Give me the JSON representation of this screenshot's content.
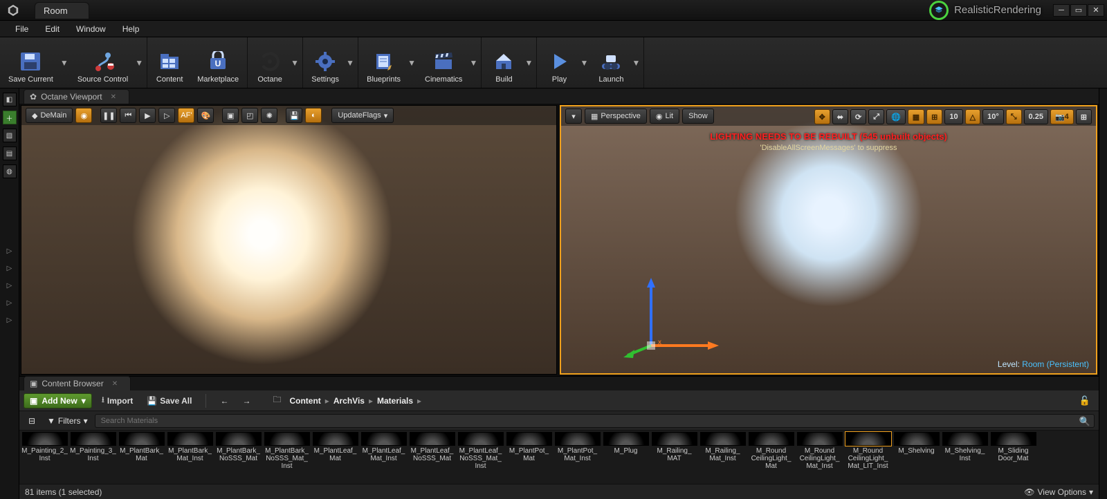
{
  "title_tab": "Room",
  "project_name": "RealisticRendering",
  "menu": {
    "file": "File",
    "edit": "Edit",
    "window": "Window",
    "help": "Help"
  },
  "toolbar": {
    "save": "Save Current",
    "source": "Source Control",
    "content": "Content",
    "market": "Marketplace",
    "octane": "Octane",
    "settings": "Settings",
    "blueprints": "Blueprints",
    "cine": "Cinematics",
    "build": "Build",
    "play": "Play",
    "launch": "Launch"
  },
  "octane_tab": "Octane Viewport",
  "octane_bar": {
    "demain": "DeMain",
    "update": "UpdateFlags"
  },
  "editor_bar": {
    "persp": "Perspective",
    "lit": "Lit",
    "show": "Show",
    "snap1": "10",
    "snap2": "10°",
    "snap3": "0.25",
    "cam": "4"
  },
  "warning": "LIGHTING NEEDS TO BE REBUILT (545 unbuilt objects)",
  "hint": "'DisableAllScreenMessages' to suppress",
  "level": {
    "label": "Level:",
    "name": "Room (Persistent)"
  },
  "cb": {
    "tab": "Content Browser",
    "addnew": "Add New",
    "import": "Import",
    "saveall": "Save All",
    "bc": [
      "Content",
      "ArchVis",
      "Materials"
    ],
    "filters": "Filters",
    "search_ph": "Search Materials",
    "status": "81 items (1 selected)",
    "viewopts": "View Options",
    "assets": [
      "M_Painting_2_Inst",
      "M_Painting_3_Inst",
      "M_PlantBark_Mat",
      "M_PlantBark_Mat_Inst",
      "M_PlantBark_NoSSS_Mat",
      "M_PlantBark_NoSSS_Mat_Inst",
      "M_PlantLeaf_Mat",
      "M_PlantLeaf_Mat_Inst",
      "M_PlantLeaf_NoSSS_Mat",
      "M_PlantLeaf_NoSSS_Mat_Inst",
      "M_PlantPot_Mat",
      "M_PlantPot_Mat_Inst",
      "M_Plug",
      "M_Railing_MAT",
      "M_Railing_Mat_Inst",
      "M_Round CeilingLight_Mat",
      "M_Round CeilingLight_Mat_Inst",
      "M_Round CeilingLight_Mat_LIT_Inst",
      "M_Shelving",
      "M_Shelving_Inst",
      "M_Sliding Door_Mat"
    ]
  },
  "icons": {
    "af": "AF",
    "af2": "AF'"
  }
}
